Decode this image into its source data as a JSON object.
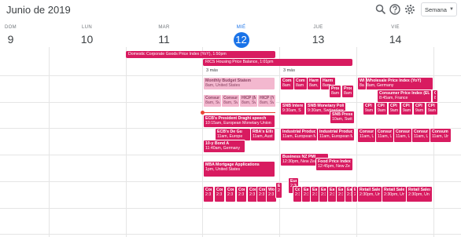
{
  "header": {
    "title": "Junio de 2019",
    "view_label": "Semana",
    "icons": [
      "search-icon",
      "help-icon",
      "gear-icon",
      "chevron-down-icon"
    ]
  },
  "days": [
    {
      "name": "DOM",
      "num": "9"
    },
    {
      "name": "LUN",
      "num": "10"
    },
    {
      "name": "MAR",
      "num": "11"
    },
    {
      "name": "MIÉ",
      "num": "12"
    },
    {
      "name": "JUE",
      "num": "13"
    },
    {
      "name": "VIE",
      "num": "14"
    }
  ],
  "allday": [
    {
      "label": "Domestic Corporate Goods Price Index (YoY), 1:50pm"
    },
    {
      "label": "RICS Housing Price Balance, 1:01pm"
    }
  ],
  "more": [
    "3 más",
    "3 más"
  ],
  "events": [
    {
      "t": "Monthly Budget Statem",
      "s": "8am, United States"
    },
    {
      "t": "Consum",
      "s": "8am, Sw"
    },
    {
      "t": "Consum",
      "s": "8am, Sw"
    },
    {
      "t": "HICP (M",
      "s": "8am, Sw"
    },
    {
      "t": "HICP (Y",
      "s": "8am, Sw"
    },
    {
      "t": "ECB's President Draghi speech",
      "s": "10:15am, European Monetary Union"
    },
    {
      "t": "ECB's De Gu",
      "s": "11am, Europe"
    },
    {
      "t": "RBA's Ellis",
      "s": "11am, Aust"
    },
    {
      "t": "10-y Bond A",
      "s": "11:40am, Germany"
    },
    {
      "t": "MBA Mortgage Applications",
      "s": "1pm, United States"
    },
    {
      "t": "Cor",
      "s": "2:3"
    },
    {
      "t": "Cor",
      "s": "2:3"
    },
    {
      "t": "Cor",
      "s": "2:3"
    },
    {
      "t": "Cor",
      "s": "2:3"
    },
    {
      "t": "Cor",
      "s": "2:3"
    },
    {
      "t": "Cor",
      "s": "2:3"
    },
    {
      "t": "Wo",
      "s": "2:3"
    },
    {
      "t": "Eu",
      "s": "2:3"
    },
    {
      "t": "Com",
      "s": "8am"
    },
    {
      "t": "Com",
      "s": "8am"
    },
    {
      "t": "Harm",
      "s": "8am,"
    },
    {
      "t": "Harm",
      "s": "8am,"
    },
    {
      "t": "Prod",
      "s": "8am"
    },
    {
      "t": "Prod",
      "s": "8am"
    },
    {
      "t": "SNB Interes",
      "s": "9:30am, S"
    },
    {
      "t": "SNB Monetary Polic",
      "s": "9:30am, Switzerland"
    },
    {
      "t": "SNB Press",
      "s": "10am, Swit"
    },
    {
      "t": "Industrial Produc",
      "s": "11am, European M"
    },
    {
      "t": "Industrial Produc",
      "s": "11am, European M"
    },
    {
      "t": "Business NZ PMI",
      "s": "12:30pm, New Zeala"
    },
    {
      "t": "Food Price Index",
      "s": "12:45pm, New Ze"
    },
    {
      "t": "Euro",
      "s": "2:30"
    },
    {
      "t": "Cor",
      "s": "2:3"
    },
    {
      "t": "Ea",
      "s": "2:3"
    },
    {
      "t": "Ea",
      "s": "2:3"
    },
    {
      "t": "Ea",
      "s": "2:3"
    },
    {
      "t": "Ea",
      "s": "2:3"
    },
    {
      "t": "Ea",
      "s": "2:3"
    },
    {
      "t": "Ea",
      "s": "2:3"
    },
    {
      "t": "Ea",
      "s": "2:3"
    },
    {
      "t": "Wholesale Price Index (YoY)",
      "s": "8am, Germany"
    },
    {
      "t": "Wh",
      "s": "8am"
    },
    {
      "t": "Consumer Price Index (EU)",
      "s": "8:45am, France"
    },
    {
      "t": "Consumer Price Index (EU)",
      "s": "8:45am, France"
    },
    {
      "t": "CPI",
      "s": "9am"
    },
    {
      "t": "CPI",
      "s": "9am"
    },
    {
      "t": "CPI",
      "s": "9am"
    },
    {
      "t": "CPI",
      "s": "9am"
    },
    {
      "t": "CPI",
      "s": "9am"
    },
    {
      "t": "CPI",
      "s": "9am"
    },
    {
      "t": "Consum",
      "s": "11am, Ur"
    },
    {
      "t": "Consum",
      "s": "11am, Ur"
    },
    {
      "t": "Consum",
      "s": "11am, Ur"
    },
    {
      "t": "Consum",
      "s": "11am, Ur"
    },
    {
      "t": "Consum",
      "s": "11am, Ur"
    },
    {
      "t": "Retail Sales",
      "s": "2:30pm, Un"
    },
    {
      "t": "Retail Sales",
      "s": "2:30pm, Un"
    },
    {
      "t": "Retail Sales",
      "s": "2:30pm, Un"
    }
  ]
}
